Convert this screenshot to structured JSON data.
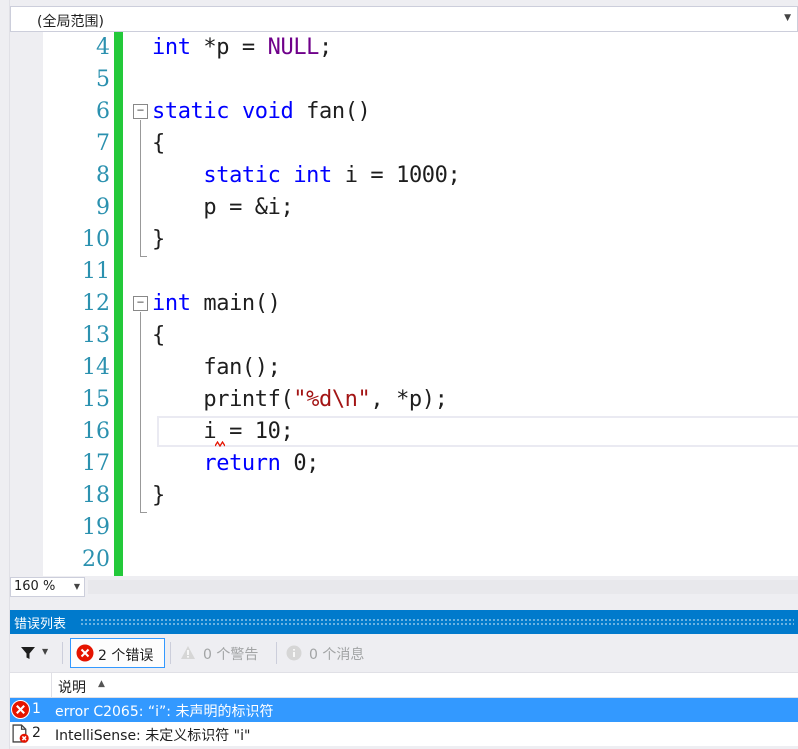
{
  "scope_bar": {
    "value": "(全局范围)"
  },
  "editor": {
    "line_numbers": [
      "4",
      "5",
      "6",
      "7",
      "8",
      "9",
      "10",
      "11",
      "12",
      "13",
      "14",
      "15",
      "16",
      "17",
      "18",
      "19",
      "20"
    ],
    "lines": [
      {
        "tokens": [
          {
            "t": "int",
            "c": "kw"
          },
          {
            "t": " *p = "
          },
          {
            "t": "NULL",
            "c": "mac"
          },
          {
            "t": ";"
          }
        ]
      },
      {
        "tokens": []
      },
      {
        "tokens": [
          {
            "t": "static",
            "c": "kw"
          },
          {
            "t": " "
          },
          {
            "t": "void",
            "c": "kw"
          },
          {
            "t": " fan()"
          }
        ]
      },
      {
        "tokens": [
          {
            "t": "{"
          }
        ]
      },
      {
        "tokens": [
          {
            "t": "    "
          },
          {
            "t": "static",
            "c": "kw"
          },
          {
            "t": " "
          },
          {
            "t": "int",
            "c": "kw"
          },
          {
            "t": " i = 1000;"
          }
        ]
      },
      {
        "tokens": [
          {
            "t": "    p = &i;"
          }
        ]
      },
      {
        "tokens": [
          {
            "t": "}"
          }
        ]
      },
      {
        "tokens": []
      },
      {
        "tokens": [
          {
            "t": "int",
            "c": "kw"
          },
          {
            "t": " main()"
          }
        ]
      },
      {
        "tokens": [
          {
            "t": "{"
          }
        ]
      },
      {
        "tokens": [
          {
            "t": "    fan();"
          }
        ]
      },
      {
        "tokens": [
          {
            "t": "    printf("
          },
          {
            "t": "\"%d\\n\"",
            "c": "str"
          },
          {
            "t": ", *p);"
          }
        ]
      },
      {
        "tokens": [
          {
            "t": "    i = 10;"
          }
        ]
      },
      {
        "tokens": [
          {
            "t": "    "
          },
          {
            "t": "return",
            "c": "kw"
          },
          {
            "t": " 0;"
          }
        ]
      },
      {
        "tokens": [
          {
            "t": "}"
          }
        ]
      },
      {
        "tokens": []
      },
      {
        "tokens": []
      }
    ]
  },
  "status_bar": {
    "zoom": "160 %"
  },
  "error_list": {
    "title": "错误列表",
    "filter_icon": "filter-icon",
    "errors_label": "2 个错误",
    "warnings_label": "0 个警告",
    "messages_label": "0 个消息",
    "column_description": "说明",
    "rows": [
      {
        "num": "1",
        "description": "error C2065: “i”: 未声明的标识符",
        "icon": "error-icon",
        "selected": true
      },
      {
        "num": "2",
        "description": "IntelliSense: 未定义标识符 \"i\"",
        "icon": "intellisense-error-icon",
        "selected": false
      }
    ]
  },
  "colors": {
    "keyword": "#0000ff",
    "macro": "#6f008a",
    "string": "#a31515",
    "line_number": "#2b91af",
    "change_bar": "#23c93a",
    "accent": "#007acc",
    "selection": "#3399ff",
    "error_red": "#e51400"
  }
}
